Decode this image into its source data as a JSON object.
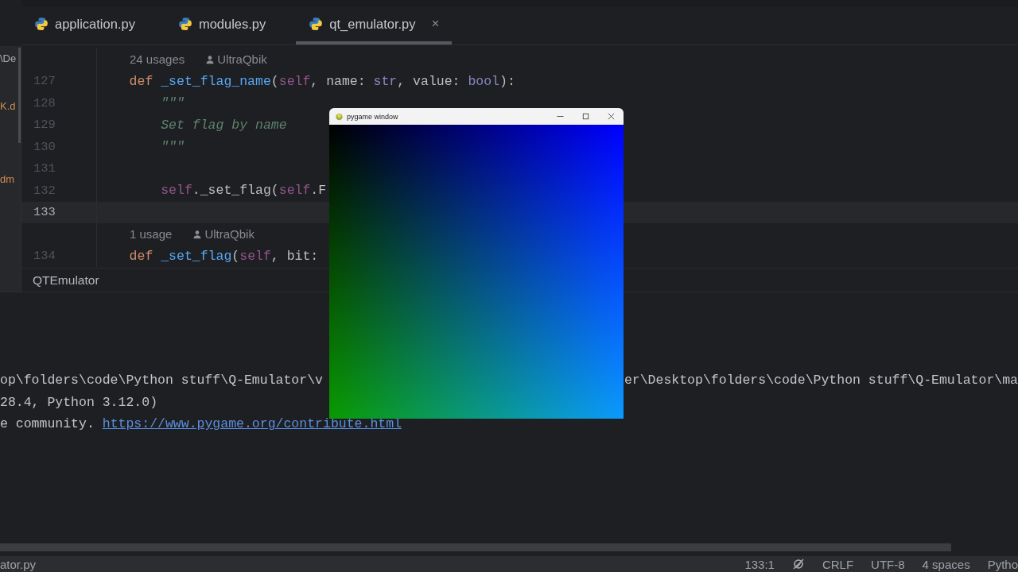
{
  "side_strip": {
    "texts": [
      {
        "text": "\\De",
        "kind": "plain"
      },
      {
        "text": "K.d",
        "kind": "file"
      },
      {
        "text": "dm",
        "kind": "file"
      }
    ]
  },
  "tabs": [
    {
      "label": "application.py",
      "selected": false
    },
    {
      "label": "modules.py",
      "selected": false
    },
    {
      "label": "qt_emulator.py",
      "selected": true,
      "close": "×"
    }
  ],
  "editor": {
    "lines": [
      {
        "kind": "hint",
        "usages": "24 usages",
        "author": "UltraQbik"
      },
      {
        "kind": "code",
        "number": "127",
        "current": false,
        "tokens": [
          {
            "t": "    def ",
            "kind": "keyword"
          },
          {
            "t": "_set_flag_name",
            "kind": "function"
          },
          {
            "t": "(",
            "kind": "plain"
          },
          {
            "t": "self",
            "kind": "self"
          },
          {
            "t": ", name: ",
            "kind": "plain"
          },
          {
            "t": "str",
            "kind": "type"
          },
          {
            "t": ", value: ",
            "kind": "plain"
          },
          {
            "t": "bool",
            "kind": "type"
          },
          {
            "t": "):",
            "kind": "plain"
          }
        ]
      },
      {
        "kind": "code",
        "number": "128",
        "current": false,
        "tokens": [
          {
            "t": "        \"\"\"",
            "kind": "doc"
          }
        ]
      },
      {
        "kind": "code",
        "number": "129",
        "current": false,
        "tokens": [
          {
            "t": "        Set flag by name",
            "kind": "doc"
          }
        ]
      },
      {
        "kind": "code",
        "number": "130",
        "current": false,
        "tokens": [
          {
            "t": "        \"\"\"",
            "kind": "doc"
          }
        ]
      },
      {
        "kind": "code",
        "number": "131",
        "current": false
      },
      {
        "kind": "code",
        "number": "132",
        "current": false,
        "tokens": [
          {
            "t": "        self",
            "kind": "self"
          },
          {
            "t": "._set_flag(",
            "kind": "plain"
          },
          {
            "t": "self",
            "kind": "self"
          },
          {
            "t": ".F",
            "kind": "plain"
          }
        ]
      },
      {
        "kind": "code",
        "number": "133",
        "current": true
      },
      {
        "kind": "hint",
        "usages": "1 usage",
        "author": "UltraQbik"
      },
      {
        "kind": "code",
        "number": "134",
        "current": false,
        "tokens": [
          {
            "t": "    def ",
            "kind": "keyword"
          },
          {
            "t": "_set_flag",
            "kind": "function"
          },
          {
            "t": "(",
            "kind": "plain"
          },
          {
            "t": "self",
            "kind": "self"
          },
          {
            "t": ", bit:",
            "kind": "plain"
          }
        ]
      }
    ],
    "breadcrumb": "QTEmulator"
  },
  "terminal": {
    "lines": [
      {
        "text": "op\\folders\\code\\Python stuff\\Q-Emulator\\v",
        "right_text": "er\\Desktop\\folders\\code\\Python stuff\\Q-Emulator\\ma"
      },
      {
        "text": "28.4, Python 3.12.0)"
      },
      {
        "text": "e community. ",
        "link": "https://www.pygame.org/contribute.html"
      }
    ]
  },
  "pygame_window": {
    "title": "pygame window"
  },
  "status_bar": {
    "file": "ator.py",
    "position": "133:1",
    "line_ending": "CRLF",
    "encoding": "UTF-8",
    "indent": "4 spaces",
    "language": "Pytho"
  }
}
